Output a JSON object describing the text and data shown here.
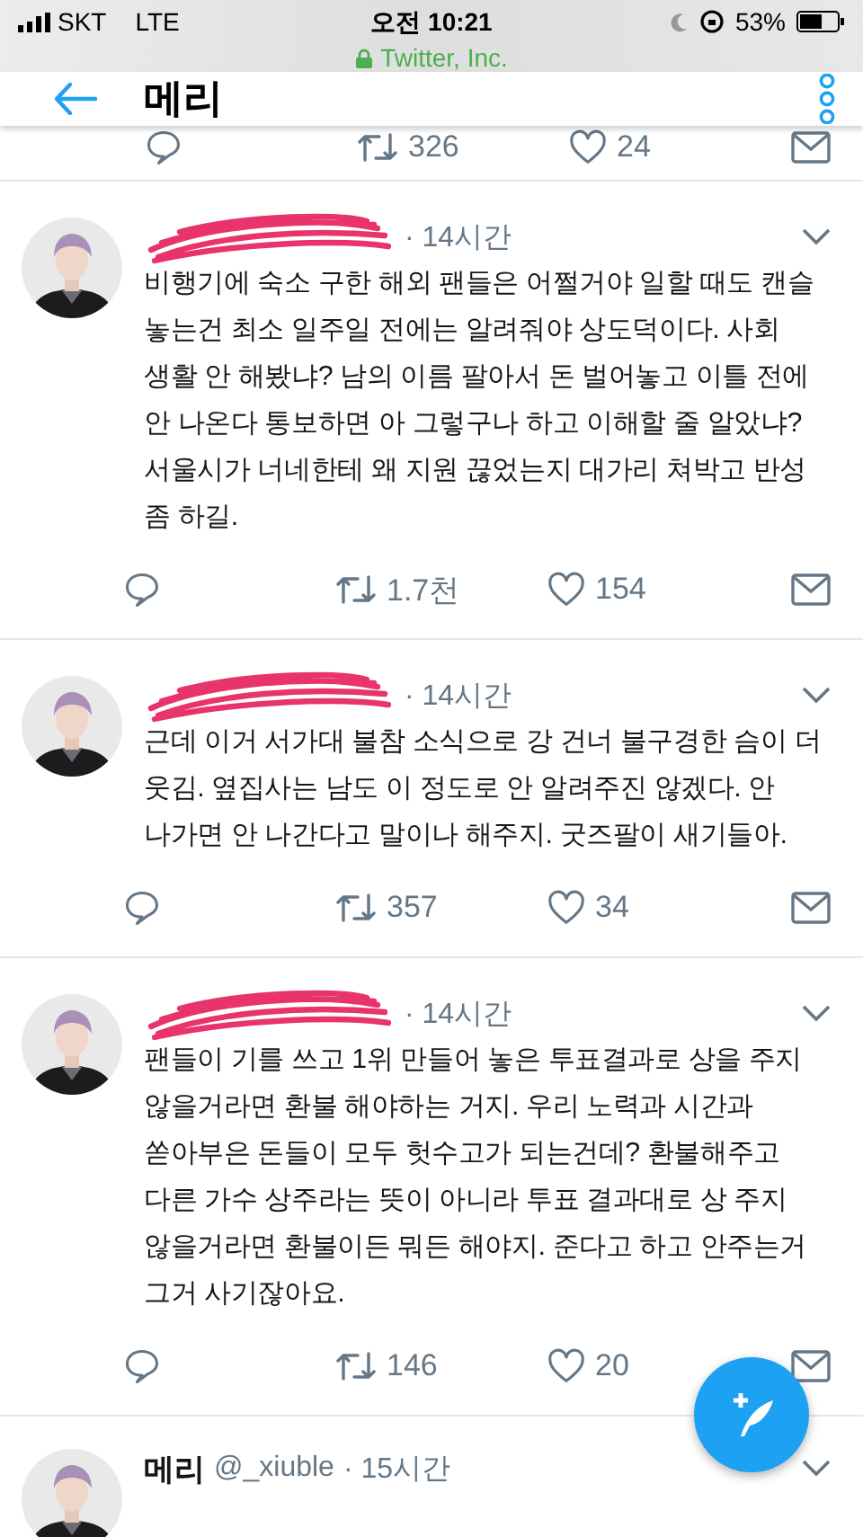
{
  "status_bar": {
    "carrier": "SKT",
    "network": "LTE",
    "time": "오전 10:21",
    "site": "Twitter, Inc.",
    "battery_text": "53%"
  },
  "header": {
    "title": "메리"
  },
  "partial_tweet": {
    "retweets": "326",
    "likes": "24"
  },
  "tweets": [
    {
      "redacted": true,
      "time": "· 14시간",
      "text": "비행기에 숙소 구한 해외 팬들은 어쩔거야 일할 때도 캔슬 놓는건 최소 일주일 전에는 알려줘야 상도덕이다. 사회 생활 안 해봤냐? 남의 이름 팔아서 돈 벌어놓고 이틀 전에 안 나온다 통보하면 아 그렇구나 하고 이해할 줄 알았냐? 서울시가 너네한테 왜 지원 끊었는지 대가리 쳐박고 반성 좀 하길.",
      "retweets": "1.7천",
      "likes": "154"
    },
    {
      "redacted": true,
      "time": "· 14시간",
      "text": "근데 이거 서가대 불참 소식으로 강 건너 불구경한 슴이 더 웃김. 옆집사는 남도 이 정도로 안 알려주진 않겠다. 안 나가면 안 나간다고 말이나 해주지. 굿즈팔이 새기들아.",
      "retweets": "357",
      "likes": "34"
    },
    {
      "redacted": true,
      "time": "· 14시간",
      "text": "팬들이 기를 쓰고 1위 만들어 놓은 투표결과로 상을 주지 않을거라면 환불 해야하는 거지. 우리 노력과 시간과 쏟아부은 돈들이 모두 헛수고가 되는건데? 환불해주고 다른 가수 상주라는 뜻이 아니라 투표 결과대로 상 주지 않을거라면 환불이든 뭐든 해야지. 준다고 하고 안주는거 그거 사기잖아요.",
      "retweets": "146",
      "likes": "20"
    },
    {
      "redacted": false,
      "name": "메리",
      "handle": "@_xiuble",
      "time": "· 15시간"
    }
  ]
}
